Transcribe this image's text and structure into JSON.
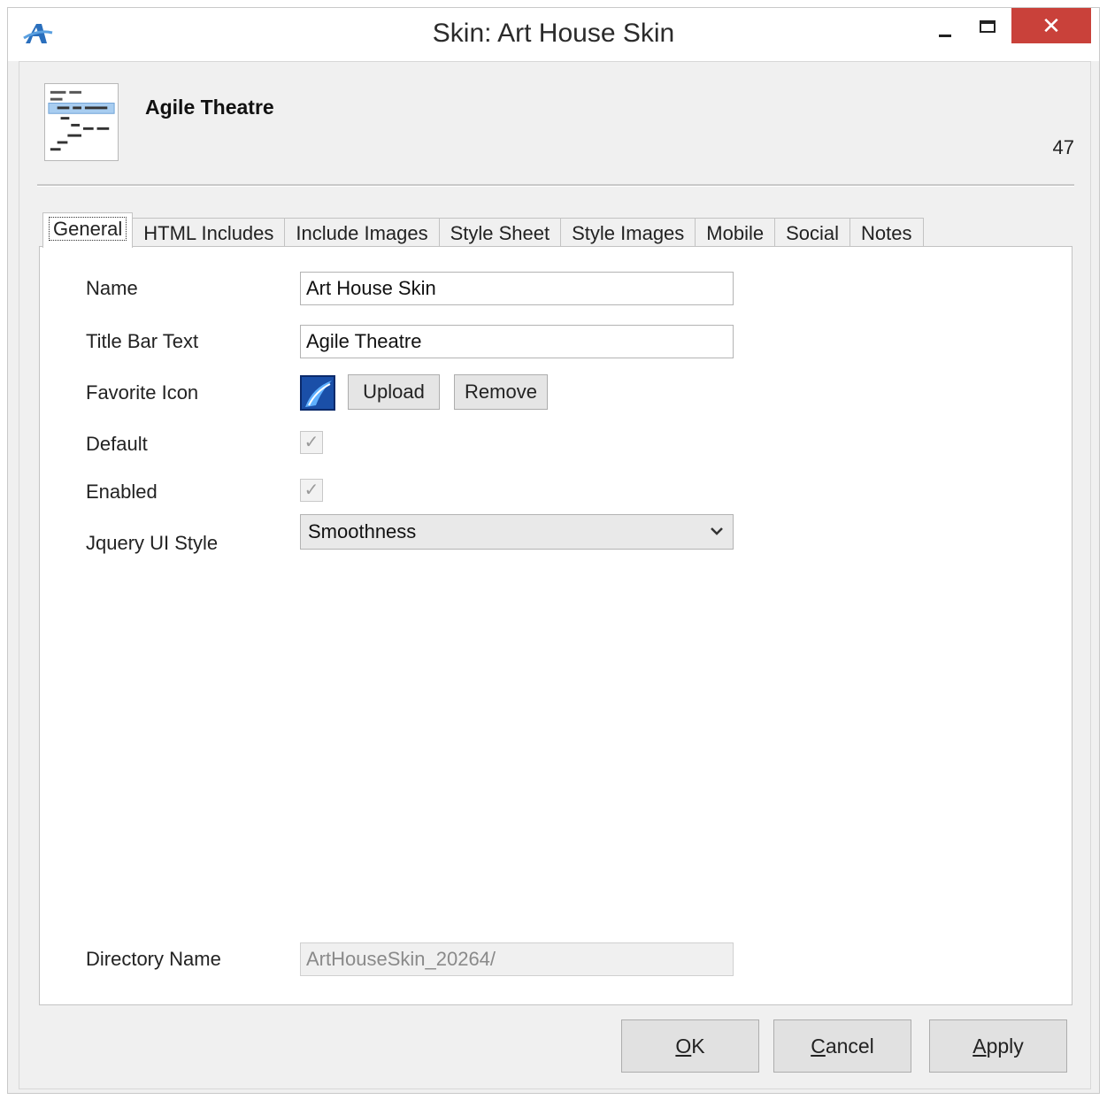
{
  "window": {
    "title": "Skin: Art House Skin",
    "app_icon": "app-logo-icon",
    "controls": {
      "minimize_icon": "minimize-icon",
      "maximize_icon": "maximize-icon",
      "close_label": "✕"
    }
  },
  "header": {
    "title": "Agile Theatre",
    "count": "47",
    "icon": "skin-document-icon"
  },
  "tabs": [
    {
      "label": "General",
      "active": true
    },
    {
      "label": "HTML Includes"
    },
    {
      "label": "Include Images"
    },
    {
      "label": "Style Sheet"
    },
    {
      "label": "Style Images"
    },
    {
      "label": "Mobile"
    },
    {
      "label": "Social"
    },
    {
      "label": "Notes"
    }
  ],
  "form": {
    "name": {
      "label": "Name",
      "value": "Art House Skin"
    },
    "title_bar_text": {
      "label": "Title Bar Text",
      "value": "Agile Theatre"
    },
    "favorite_icon": {
      "label": "Favorite Icon",
      "upload_label": "Upload",
      "remove_label": "Remove"
    },
    "default": {
      "label": "Default",
      "checked": true
    },
    "enabled": {
      "label": "Enabled",
      "checked": true
    },
    "jquery_ui_style": {
      "label": "Jquery UI Style",
      "value": "Smoothness"
    },
    "directory_name": {
      "label": "Directory Name",
      "value": "ArtHouseSkin_20264/"
    }
  },
  "footer": {
    "ok_underline": "O",
    "ok_rest": "K",
    "cancel_underline": "C",
    "cancel_rest": "ancel",
    "apply_underline": "A",
    "apply_rest": "pply"
  },
  "colors": {
    "close_button": "#c9413a",
    "accent_blue": "#1f5fa8"
  }
}
